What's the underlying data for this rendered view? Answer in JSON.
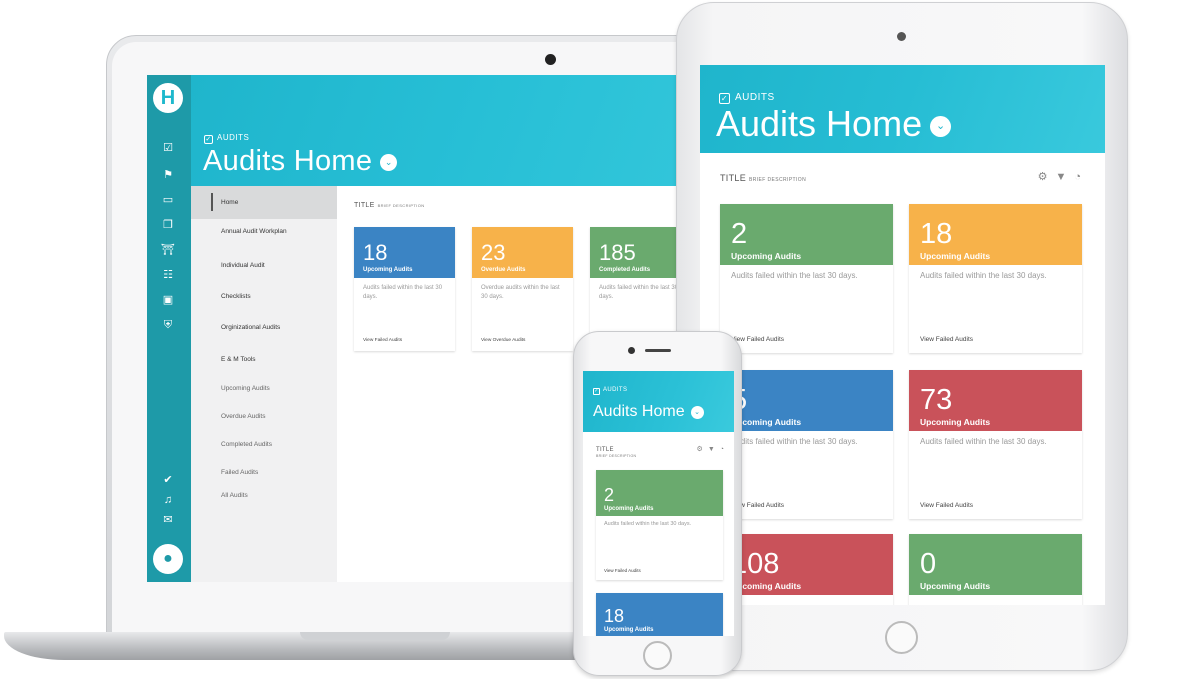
{
  "app": {
    "breadcrumb": "AUDITS",
    "title": "Audits Home",
    "logo_glyph": "H"
  },
  "colors": {
    "teal": "#1fb5cc",
    "rail": "#1e9aa8",
    "blue": "#3b84c4",
    "orange": "#f7b24a",
    "green": "#6aaa6e",
    "red": "#c9525a"
  },
  "section": {
    "title": "TITLE",
    "subtitle": "BRIEF DESCRIPTION"
  },
  "rail_icons": [
    "checkbox-icon",
    "flag-icon",
    "folder-icon",
    "documents-icon",
    "bank-icon",
    "org-chart-icon",
    "briefcase-icon",
    "shield-icon",
    "check-badge-icon",
    "bell-icon",
    "mail-icon"
  ],
  "nav": {
    "items": [
      "Home",
      "Annual Audit Workplan",
      "Individual Audit",
      "Checklists",
      "Orginizational Audits",
      "E & M Tools"
    ],
    "subitems": [
      "Upcoming Audits",
      "Overdue Audits",
      "Completed Audits",
      "Failed Audits",
      "All Audits"
    ]
  },
  "laptop_cards": [
    {
      "value": "18",
      "label": "Upcoming Audits",
      "desc": "Audits failed within the last 30 days.",
      "link": "View Failed Audits"
    },
    {
      "value": "23",
      "label": "Overdue Audits",
      "desc": "Overdue audits within the last 30 days.",
      "link": "View Overdue Audits"
    },
    {
      "value": "185",
      "label": "Completed Audits",
      "desc": "Audits failed within the last 30 days.",
      "link": "View Failed Audits"
    }
  ],
  "tablet_cards": [
    {
      "value": "2",
      "label": "Upcoming Audits",
      "desc": "Audits failed within the last 30 days.",
      "link": "View Failed Audits"
    },
    {
      "value": "18",
      "label": "Upcoming Audits",
      "desc": "Audits failed within the last 30 days.",
      "link": "View Failed Audits"
    },
    {
      "value": "5",
      "label": "Upcoming Audits",
      "desc": "Audits failed within the last 30 days.",
      "link": "View Failed Audits"
    },
    {
      "value": "73",
      "label": "Upcoming Audits",
      "desc": "Audits failed within the last 30 days.",
      "link": "View Failed Audits"
    },
    {
      "value": "108",
      "label": "Upcoming Audits"
    },
    {
      "value": "0",
      "label": "Upcoming Audits"
    }
  ],
  "phone_cards": [
    {
      "value": "2",
      "label": "Upcoming Audits",
      "desc": "Audits failed within the last 30 days.",
      "link": "View Failed Audits"
    },
    {
      "value": "18",
      "label": "Upcoming Audits"
    }
  ]
}
